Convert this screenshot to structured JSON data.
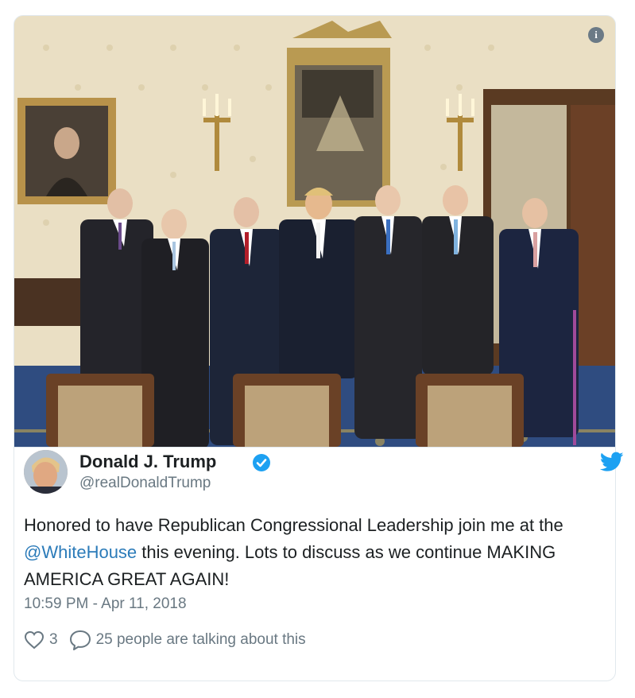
{
  "tweet": {
    "display_name": "Donald J. Trump",
    "handle": "@realDonaldTrump",
    "text_before": "Honored to have Republican Congressional Leadership join me at the ",
    "mention": "@WhiteHouse",
    "text_after": " this evening. Lots to discuss as we continue MAKING AMERICA GREAT AGAIN!",
    "timestamp": "10:59 PM - Apr 11, 2018",
    "like_count": "3",
    "talking_label": "25 people are talking about this"
  },
  "icons": {
    "info": "info-icon",
    "verified": "verified-badge-icon",
    "twitter": "twitter-bird-icon",
    "like": "heart-icon",
    "reply": "speech-bubble-icon"
  },
  "colors": {
    "link": "#2b7bb9",
    "verified": "#1da1f2",
    "muted": "#697882",
    "text": "#1c2022"
  }
}
